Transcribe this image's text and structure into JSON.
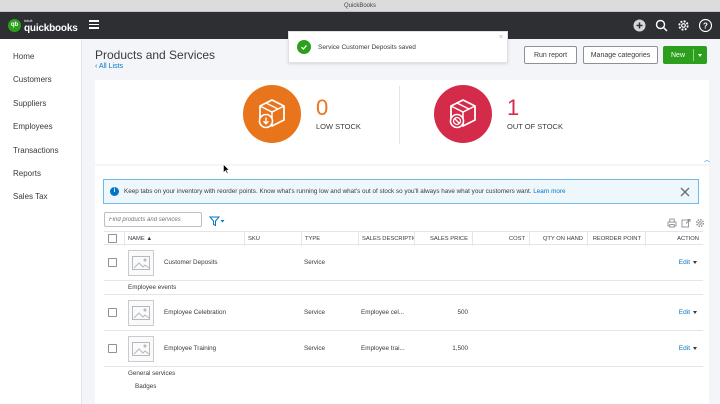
{
  "window": {
    "title": "QuickBooks"
  },
  "brand": {
    "intuit": "intuit",
    "name": "quickbooks",
    "badge": "qb"
  },
  "sidebar": {
    "items": [
      {
        "label": "Home"
      },
      {
        "label": "Customers"
      },
      {
        "label": "Suppliers"
      },
      {
        "label": "Employees"
      },
      {
        "label": "Transactions"
      },
      {
        "label": "Reports"
      },
      {
        "label": "Sales Tax"
      }
    ]
  },
  "page": {
    "title": "Products and Services",
    "back_link": "All Lists"
  },
  "toast": {
    "message": "Service Customer Deposits saved",
    "close": "×"
  },
  "toolbar": {
    "run_report": "Run report",
    "manage_categories": "Manage categories",
    "new": "New"
  },
  "stock": {
    "low": {
      "count": "0",
      "label": "LOW STOCK"
    },
    "out": {
      "count": "1",
      "label": "OUT OF STOCK"
    }
  },
  "banner": {
    "text": "Keep tabs on your inventory with reorder points. Know what's running low and what's out of stock so you'll always have what your customers want.",
    "link": "Learn more",
    "info": "i"
  },
  "filter": {
    "placeholder": "Find products and services"
  },
  "table": {
    "columns": {
      "name": "NAME ▲",
      "sku": "SKU",
      "type": "TYPE",
      "sales_desc": "SALES DESCRIPTIO",
      "sales_price": "SALES PRICE",
      "cost": "COST",
      "qty": "QTY ON HAND",
      "reorder": "REORDER POINT",
      "action": "ACTION"
    },
    "rows": [
      {
        "name": "Customer Deposits",
        "type": "Service",
        "desc": "",
        "price": "",
        "action": "Edit"
      },
      {
        "group": "Employee events"
      },
      {
        "name": "Employee Celebration",
        "type": "Service",
        "desc": "Employee cel...",
        "price": "500",
        "action": "Edit"
      },
      {
        "name": "Employee Training",
        "type": "Service",
        "desc": "Employee trai...",
        "price": "1,500",
        "action": "Edit"
      },
      {
        "group": "General services"
      },
      {
        "subgroup": "Badges"
      }
    ]
  },
  "colors": {
    "accent_green": "#2ca01c",
    "low_stock": "#e8741c",
    "out_of_stock": "#d52b4a",
    "link": "#0077c5",
    "topbar": "#2d2f33"
  }
}
